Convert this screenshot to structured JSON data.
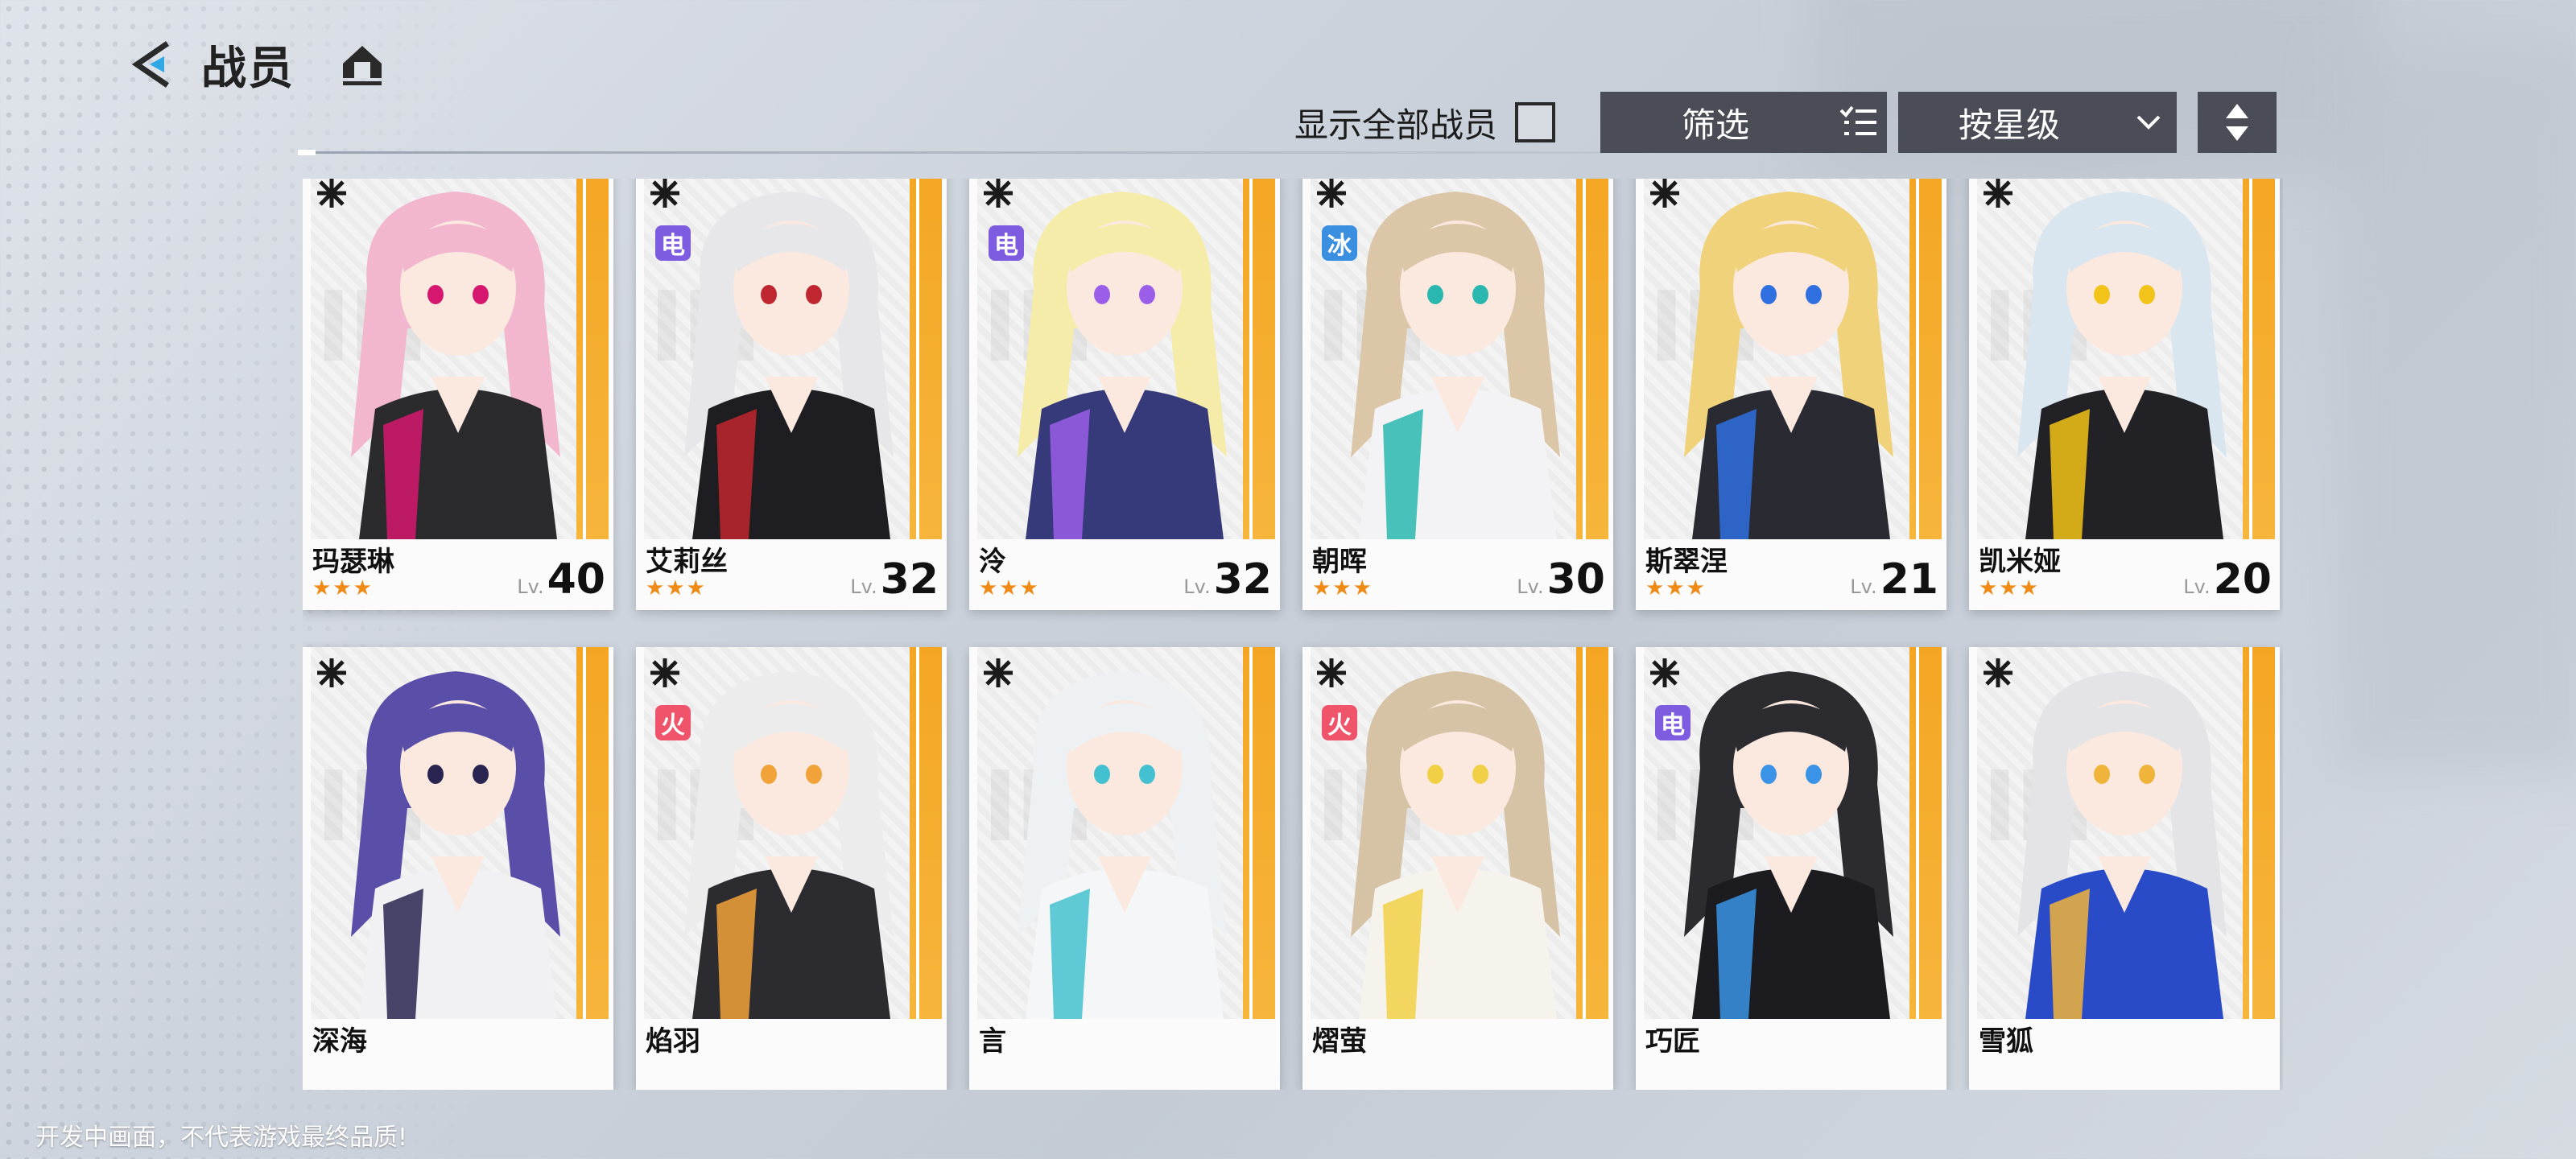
{
  "header": {
    "title": "战员",
    "back_icon": "back-arrow-icon",
    "home_icon": "home-icon"
  },
  "controls": {
    "show_all_label": "显示全部战员",
    "show_all_checked": false,
    "filter_label": "筛选",
    "sort_label": "按星级",
    "order_icon": "sort-order-icon"
  },
  "colors": {
    "accent": "#f4a623",
    "control_bg": "#4a4d55",
    "element_dian": "#7e5ce0",
    "element_bing": "#3a8fe0",
    "element_huo": "#f0546a",
    "star": "#f08a16"
  },
  "characters": [
    {
      "name": "玛瑟琳",
      "stars": "★★★",
      "lv_prefix": "Lv.",
      "level": "40",
      "element": "",
      "hair": "#f2b6cf",
      "outfit": "#2b2b2e",
      "accent": "#d6176f"
    },
    {
      "name": "艾莉丝",
      "stars": "★★★",
      "lv_prefix": "Lv.",
      "level": "32",
      "element": "电",
      "element_type": "dian",
      "hair": "#e7e7ea",
      "outfit": "#1d1d22",
      "accent": "#c0262f"
    },
    {
      "name": "泠",
      "stars": "★★★",
      "lv_prefix": "Lv.",
      "level": "32",
      "element": "电",
      "element_type": "dian",
      "hair": "#f5ecaa",
      "outfit": "#363a7a",
      "accent": "#9a5ee8"
    },
    {
      "name": "朝晖",
      "stars": "★★★",
      "lv_prefix": "Lv.",
      "level": "30",
      "element": "冰",
      "element_type": "bing",
      "hair": "#dcc6a8",
      "outfit": "#f3f3f5",
      "accent": "#2ab7b0"
    },
    {
      "name": "斯翠涅",
      "stars": "★★★",
      "lv_prefix": "Lv.",
      "level": "21",
      "element": "",
      "hair": "#f0d27a",
      "outfit": "#2a2a33",
      "accent": "#2f6fe0"
    },
    {
      "name": "凯米娅",
      "stars": "★★★",
      "lv_prefix": "Lv.",
      "level": "20",
      "element": "",
      "hair": "#d9e6ef",
      "outfit": "#222226",
      "accent": "#f2c318"
    },
    {
      "name": "深海",
      "element": "",
      "hair": "#5a4fa8",
      "outfit": "#f1f1f4",
      "accent": "#2a2550"
    },
    {
      "name": "焰羽",
      "element": "火",
      "element_type": "huo",
      "hair": "#ececec",
      "outfit": "#2b2b30",
      "accent": "#f1a238"
    },
    {
      "name": "言",
      "element": "",
      "hair": "#eef1f3",
      "outfit": "#f4f6f8",
      "accent": "#44c1d0"
    },
    {
      "name": "熠萤",
      "element": "火",
      "element_type": "huo",
      "hair": "#d6c3a6",
      "outfit": "#f6f3ec",
      "accent": "#f2d046"
    },
    {
      "name": "巧匠",
      "element": "电",
      "element_type": "dian",
      "hair": "#2c2c30",
      "outfit": "#1c1c20",
      "accent": "#3a93e6"
    },
    {
      "name": "雪狐",
      "element": "",
      "hair": "#e4e4e6",
      "outfit": "#2a4bc8",
      "accent": "#f0b43a"
    }
  ],
  "card_watermark": "IN",
  "footer_note": "开发中画面，不代表游戏最终品质!"
}
